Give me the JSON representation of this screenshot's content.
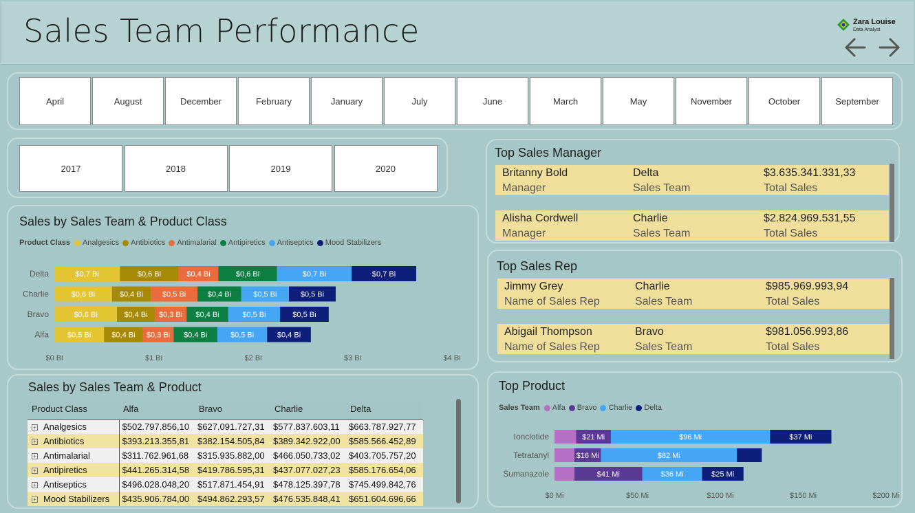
{
  "header": {
    "title": "Sales Team Performance",
    "logo_name": "Zara Louise",
    "logo_sub": "Data Analyst"
  },
  "months": [
    "April",
    "August",
    "December",
    "February",
    "January",
    "July",
    "June",
    "March",
    "May",
    "November",
    "October",
    "September"
  ],
  "years": [
    "2017",
    "2018",
    "2019",
    "2020"
  ],
  "chart_data": [
    {
      "type": "bar",
      "orientation": "horizontal-stacked",
      "title": "Sales by Sales Team & Product Class",
      "legend_title": "Product Class",
      "legend_position": "top-left",
      "categories": [
        "Delta",
        "Charlie",
        "Bravo",
        "Alfa"
      ],
      "xlim": [
        0,
        4
      ],
      "xticks": [
        "$0 Bi",
        "$1 Bi",
        "$2 Bi",
        "$3 Bi",
        "$4 Bi"
      ],
      "series": [
        {
          "name": "Analgesics",
          "color": "#e3c432",
          "values": [
            0.66,
            0.58,
            0.63,
            0.5
          ],
          "labels": [
            "$0,7 Bi",
            "$0,6 Bi",
            "$0,6 Bi",
            "$0,5 Bi"
          ]
        },
        {
          "name": "Antibiotics",
          "color": "#a68a06",
          "values": [
            0.59,
            0.39,
            0.38,
            0.39
          ],
          "labels": [
            "$0,6 Bi",
            "$0,4 Bi",
            "$0,4 Bi",
            "$0,4 Bi"
          ]
        },
        {
          "name": "Antimalarial",
          "color": "#ea6b3b",
          "values": [
            0.4,
            0.47,
            0.32,
            0.31
          ],
          "labels": [
            "$0,4 Bi",
            "$0,5 Bi",
            "$0,3 Bi",
            "$0,3 Bi"
          ]
        },
        {
          "name": "Antipiretics",
          "color": "#0d7f43",
          "values": [
            0.59,
            0.44,
            0.42,
            0.44
          ],
          "labels": [
            "$0,6 Bi",
            "$0,4 Bi",
            "$0,4 Bi",
            "$0,4 Bi"
          ]
        },
        {
          "name": "Antiseptics",
          "color": "#45a6f5",
          "values": [
            0.75,
            0.48,
            0.52,
            0.5
          ],
          "labels": [
            "$0,7 Bi",
            "$0,5 Bi",
            "$0,5 Bi",
            "$0,5 Bi"
          ]
        },
        {
          "name": "Mood Stabilizers",
          "color": "#0e1e7b",
          "values": [
            0.65,
            0.47,
            0.49,
            0.44
          ],
          "labels": [
            "$0,7 Bi",
            "$0,5 Bi",
            "$0,5 Bi",
            "$0,4 Bi"
          ]
        }
      ]
    },
    {
      "type": "bar",
      "orientation": "horizontal-stacked",
      "title": "Top Product",
      "legend_title": "Sales Team",
      "legend_position": "top-left",
      "categories": [
        "Ionclotide",
        "Tetratanyl",
        "Sumanazole"
      ],
      "xlim": [
        0,
        200
      ],
      "xticks": [
        "$0 Mi",
        "$50 Mi",
        "$100 Mi",
        "$150 Mi",
        "$200 Mi"
      ],
      "series": [
        {
          "name": "Alfa",
          "color": "#b76fc6",
          "values": [
            13,
            12,
            12
          ],
          "labels": [
            "",
            "",
            ""
          ]
        },
        {
          "name": "Bravo",
          "color": "#5b3a96",
          "values": [
            21,
            16,
            41
          ],
          "labels": [
            "$21 Mi",
            "$16 Mi",
            "$41 Mi"
          ]
        },
        {
          "name": "Charlie",
          "color": "#45a6f5",
          "values": [
            96,
            82,
            36
          ],
          "labels": [
            "$96 Mi",
            "$82 Mi",
            "$36 Mi"
          ]
        },
        {
          "name": "Delta",
          "color": "#0e1e7b",
          "values": [
            37,
            15,
            25
          ],
          "labels": [
            "$37 Mi",
            "",
            "$25 Mi"
          ]
        }
      ]
    }
  ],
  "top_manager": {
    "title": "Top Sales Manager",
    "rows": [
      {
        "name": "Britanny Bold",
        "name_label": "Manager",
        "team": "Delta",
        "team_label": "Sales Team",
        "sales": "$3.635.341.331,33",
        "sales_label": "Total Sales"
      },
      {
        "name": "Alisha Cordwell",
        "name_label": "Manager",
        "team": "Charlie",
        "team_label": "Sales Team",
        "sales": "$2.824.969.531,55",
        "sales_label": "Total Sales"
      }
    ]
  },
  "top_rep": {
    "title": "Top Sales Rep",
    "rows": [
      {
        "name": "Jimmy Grey",
        "name_label": "Name of Sales Rep",
        "team": "Charlie",
        "team_label": "Sales Team",
        "sales": "$985.969.993,94",
        "sales_label": "Total Sales"
      },
      {
        "name": "Abigail Thompson",
        "name_label": "Name of Sales Rep",
        "team": "Bravo",
        "team_label": "Sales Team",
        "sales": "$981.056.993,86",
        "sales_label": "Total Sales"
      }
    ]
  },
  "matrix": {
    "title": "Sales by Sales Team & Product",
    "columns": [
      "Product Class",
      "Alfa",
      "Bravo",
      "Charlie",
      "Delta"
    ],
    "rows": [
      [
        "Analgesics",
        "$502.797.856,10",
        "$627.091.727,31",
        "$577.837.603,11",
        "$663.787.927,77"
      ],
      [
        "Antibiotics",
        "$393.213.355,81",
        "$382.154.505,84",
        "$389.342.922,00",
        "$585.566.452,89"
      ],
      [
        "Antimalarial",
        "$311.762.961,68",
        "$315.935.882,00",
        "$466.050.733,02",
        "$403.705.757,20"
      ],
      [
        "Antipiretics",
        "$441.265.314,58",
        "$419.786.595,31",
        "$437.077.027,23",
        "$585.176.654,06"
      ],
      [
        "Antiseptics",
        "$496.028.048,20",
        "$517.871.454,91",
        "$478.125.397,78",
        "$745.499.842,76"
      ],
      [
        "Mood Stabilizers",
        "$435.906.784,00",
        "$494.862.293,57",
        "$476.535.848,41",
        "$651.604.696,66"
      ]
    ]
  }
}
